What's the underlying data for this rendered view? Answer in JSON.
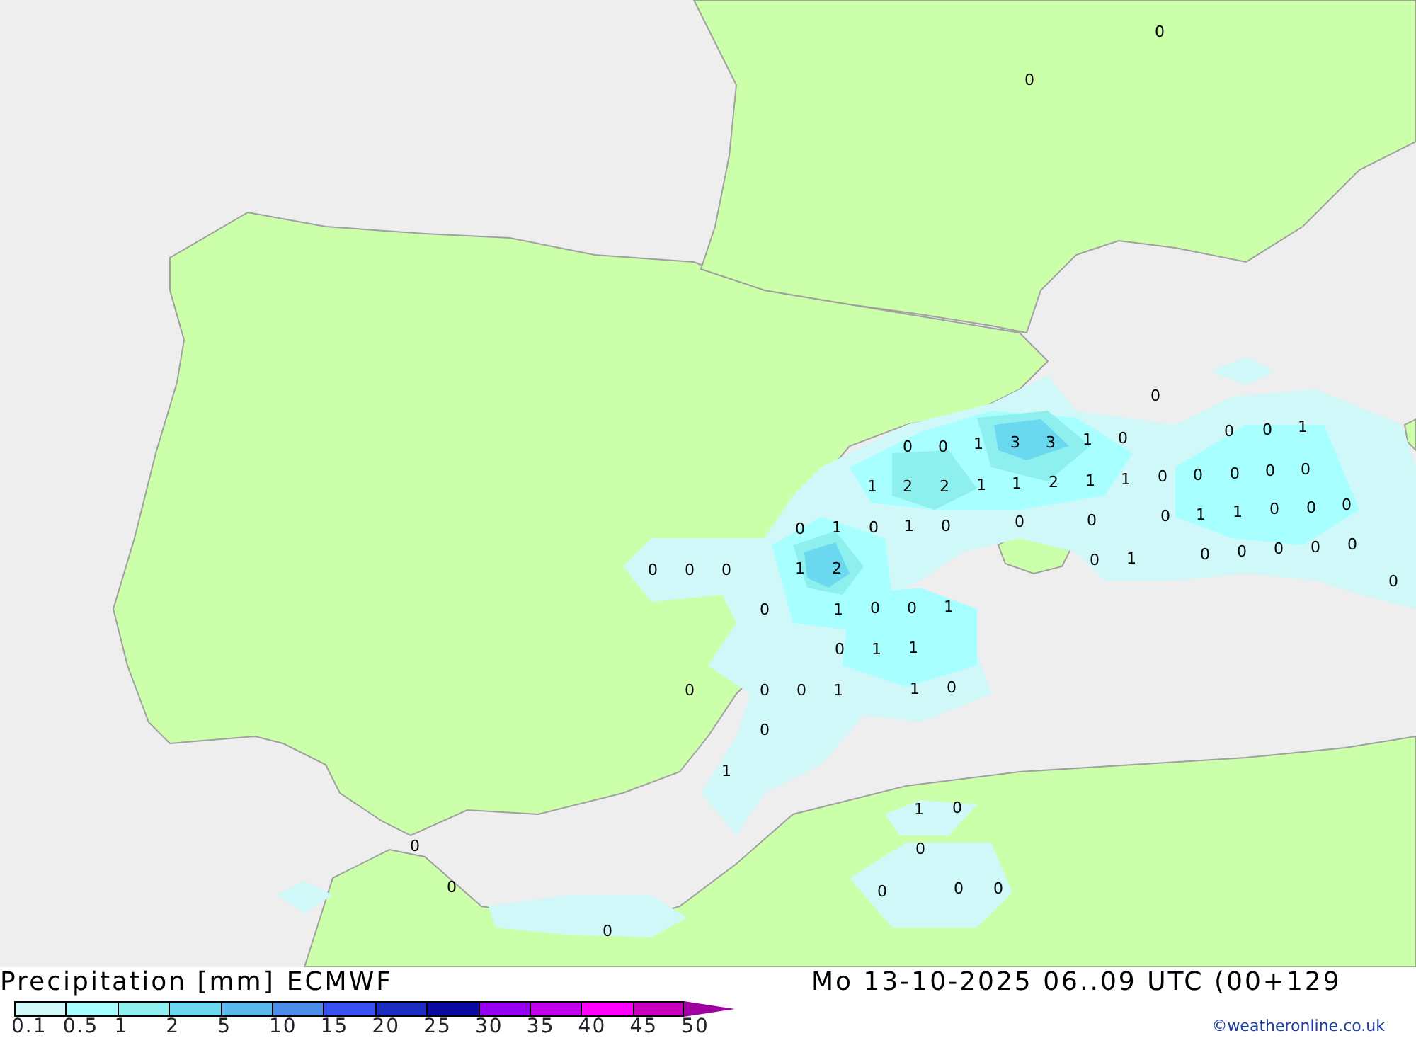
{
  "map": {
    "value_labels": [
      "0",
      "0",
      "0",
      "0",
      "0",
      "1",
      "3",
      "3",
      "1",
      "0",
      "0",
      "0",
      "1",
      "1",
      "2",
      "2",
      "1",
      "1",
      "2",
      "1",
      "1",
      "0",
      "0",
      "0",
      "0",
      "0",
      "0",
      "1",
      "0",
      "1",
      "0",
      "0",
      "0",
      "0",
      "1",
      "1",
      "0",
      "0",
      "0",
      "0",
      "0",
      "0",
      "1",
      "2",
      "0",
      "1",
      "0",
      "0",
      "0",
      "0",
      "0",
      "0",
      "0",
      "1",
      "0",
      "0",
      "1",
      "0",
      "1",
      "1",
      "0",
      "0",
      "0",
      "1",
      "1",
      "0",
      "0",
      "1",
      "1",
      "0",
      "0",
      "0",
      "0",
      "0",
      "0",
      "0",
      "0"
    ]
  },
  "legend": {
    "title": "Precipitation [mm]",
    "model": "ECMWF",
    "scale": [
      {
        "label": "0.1",
        "color": "#d0f8f8",
        "kind": "box"
      },
      {
        "label": "0.5",
        "color": "#a8ffff",
        "kind": "box"
      },
      {
        "label": "1",
        "color": "#8ef0ee",
        "kind": "box"
      },
      {
        "label": "2",
        "color": "#6ad8ee",
        "kind": "box"
      },
      {
        "label": "5",
        "color": "#5ab8ec",
        "kind": "box"
      },
      {
        "label": "10",
        "color": "#4c8ce8",
        "kind": "box"
      },
      {
        "label": "15",
        "color": "#3a50f0",
        "kind": "box"
      },
      {
        "label": "20",
        "color": "#1a2dc0",
        "kind": "box"
      },
      {
        "label": "25",
        "color": "#0a0a9e",
        "kind": "box"
      },
      {
        "label": "30",
        "color": "#9400f0",
        "kind": "box"
      },
      {
        "label": "35",
        "color": "#c000e8",
        "kind": "box"
      },
      {
        "label": "40",
        "color": "#ff00ff",
        "kind": "box"
      },
      {
        "label": "45",
        "color": "#c800c0",
        "kind": "box"
      },
      {
        "label": "50",
        "color": "#a000a0",
        "kind": "arrow"
      }
    ]
  },
  "run_info": "Mo 13-10-2025 06..09 UTC (00+129",
  "credit": "©weatheronline.co.uk"
}
